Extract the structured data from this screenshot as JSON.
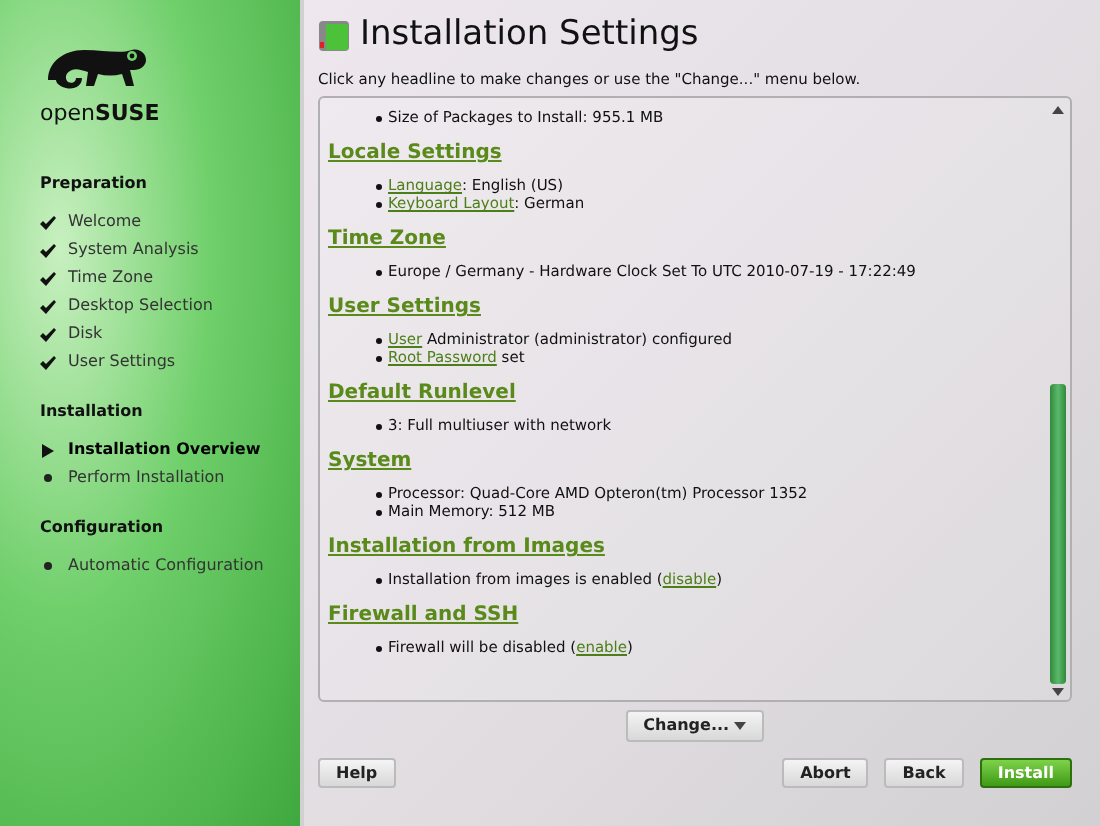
{
  "sidebar": {
    "logo_text": "open**SUSE**",
    "groups": [
      {
        "title": "Preparation",
        "steps": [
          {
            "label": "Welcome",
            "checked": true,
            "selected": false
          },
          {
            "label": "System Analysis",
            "checked": true,
            "selected": false
          },
          {
            "label": "Time Zone",
            "checked": true,
            "selected": false
          },
          {
            "label": "Desktop Selection",
            "checked": true,
            "selected": false
          },
          {
            "label": "Disk",
            "checked": true,
            "selected": false
          },
          {
            "label": "User Settings",
            "checked": true,
            "selected": false
          }
        ]
      },
      {
        "title": "Installation",
        "steps": [
          {
            "label": "Installation Overview",
            "checked": false,
            "selected": true
          },
          {
            "label": "Perform Installation",
            "checked": false,
            "selected": false
          }
        ]
      },
      {
        "title": "Configuration",
        "steps": [
          {
            "label": "Automatic Configuration",
            "checked": false,
            "selected": false
          }
        ]
      }
    ]
  },
  "main": {
    "title": "Installation Settings",
    "instruction": "Click any headline to make changes or use the \"Change...\" menu below.",
    "summary": {
      "top_items": [
        [
          {
            "text": "Size of Packages to Install: 955.1 MB"
          }
        ]
      ],
      "sections": [
        {
          "heading": "Locale Settings",
          "items": [
            [
              {
                "text": "Language",
                "link": true
              },
              {
                "text": ": English (US)"
              }
            ],
            [
              {
                "text": "Keyboard Layout",
                "link": true
              },
              {
                "text": ": German"
              }
            ]
          ]
        },
        {
          "heading": "Time Zone",
          "items": [
            [
              {
                "text": "Europe / Germany - Hardware Clock Set To UTC 2010-07-19 - 17:22:49"
              }
            ]
          ]
        },
        {
          "heading": "User Settings",
          "items": [
            [
              {
                "text": "User",
                "link": true
              },
              {
                "text": " Administrator (administrator) configured"
              }
            ],
            [
              {
                "text": "Root Password",
                "link": true
              },
              {
                "text": " set"
              }
            ]
          ]
        },
        {
          "heading": "Default Runlevel",
          "items": [
            [
              {
                "text": "3: Full multiuser with network"
              }
            ]
          ]
        },
        {
          "heading": "System",
          "items": [
            [
              {
                "text": "Processor: Quad-Core AMD Opteron(tm) Processor 1352"
              }
            ],
            [
              {
                "text": "Main Memory: 512 MB"
              }
            ]
          ]
        },
        {
          "heading": "Installation from Images",
          "items": [
            [
              {
                "text": "Installation from images is enabled ("
              },
              {
                "text": "disable",
                "link": true
              },
              {
                "text": ")"
              }
            ]
          ]
        },
        {
          "heading": "Firewall and SSH",
          "items": [
            [
              {
                "text": "Firewall will be disabled ("
              },
              {
                "text": "enable",
                "link": true
              },
              {
                "text": ")"
              }
            ]
          ]
        }
      ]
    },
    "change_button": "Change...",
    "buttons": [
      {
        "label": "Help",
        "kind": "normal"
      },
      {
        "label": "Abort",
        "kind": "normal"
      },
      {
        "label": "Back",
        "kind": "normal"
      },
      {
        "label": "Install",
        "kind": "primary"
      }
    ]
  }
}
